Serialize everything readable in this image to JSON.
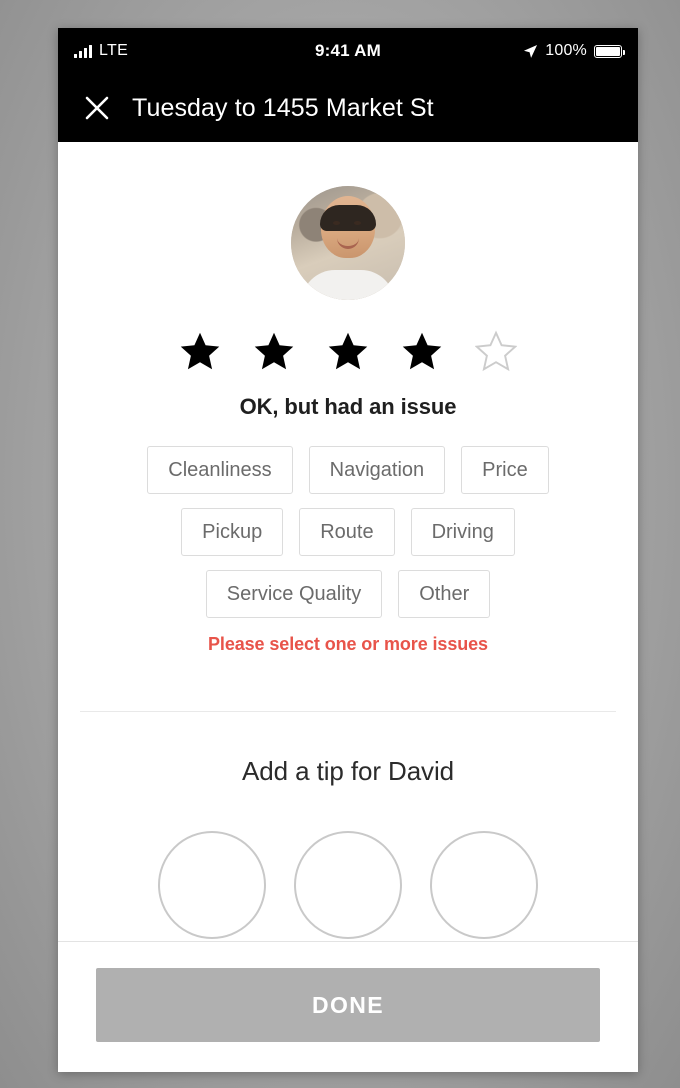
{
  "status_bar": {
    "carrier": "LTE",
    "time": "9:41 AM",
    "battery_percent": "100%",
    "signal_icon": "signal-bars-icon",
    "location_icon": "location-arrow-icon",
    "battery_icon": "battery-full-icon"
  },
  "navbar": {
    "close_icon": "close-x-icon",
    "title": "Tuesday to 1455 Market St"
  },
  "rating": {
    "avatar_alt": "driver-avatar",
    "stars_total": 5,
    "stars_filled": 4,
    "label": "OK, but had an issue",
    "issue_rows": [
      [
        "Cleanliness",
        "Navigation",
        "Price"
      ],
      [
        "Pickup",
        "Route",
        "Driving"
      ],
      [
        "Service Quality",
        "Other"
      ]
    ],
    "error_message": "Please select one or more issues",
    "error_color": "#e8544a"
  },
  "tip": {
    "title": "Add a tip for David",
    "options_count": 3
  },
  "footer": {
    "done_label": "DONE",
    "done_color": "#b0b0b0"
  }
}
